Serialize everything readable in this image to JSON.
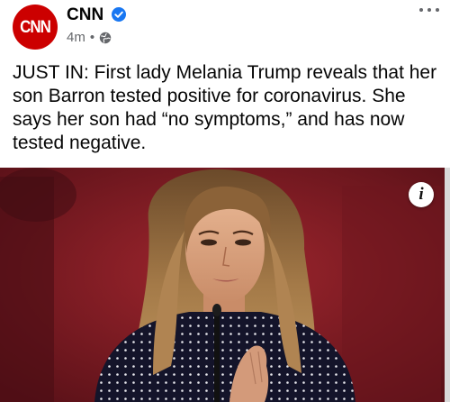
{
  "post": {
    "page_name": "CNN",
    "avatar_text": "CNN",
    "timestamp": "4m",
    "separator": "•",
    "audience_icon": "globe-icon",
    "verified_icon": "verified-badge-icon",
    "more_icon": "more-options-icon",
    "caption": "JUST IN: First lady Melania Trump reveals that her son Barron tested positive for coronavirus. She says her son had “no symptoms,” and has now tested negative.",
    "info_icon": "i"
  },
  "colors": {
    "brand": "#cc0000",
    "verified": "#1877f2",
    "meta_text": "#65676b",
    "text": "#050505"
  }
}
